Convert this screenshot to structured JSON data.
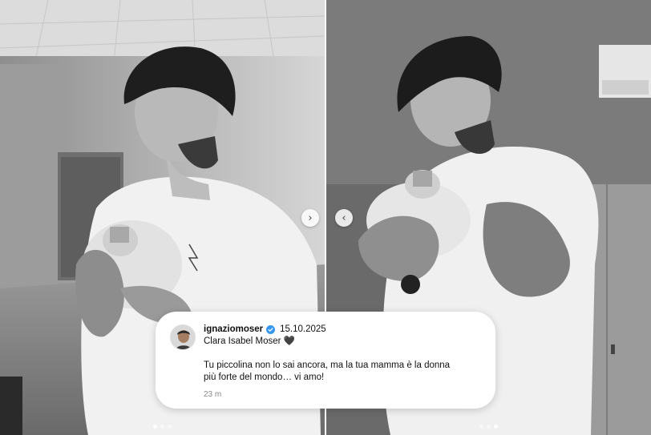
{
  "carousel_left": {
    "image_alt": "Man holding a newborn baby in a hospital room",
    "next_icon": "chevron-right-icon",
    "dots": [
      false,
      false,
      false
    ],
    "active_dot": 0
  },
  "carousel_right": {
    "image_alt": "Man smiling while cradling a newborn baby",
    "prev_icon": "chevron-left-icon",
    "active_dot": 2
  },
  "caption": {
    "username": "ignaziomoser",
    "verified": true,
    "date": "15.10.2025",
    "title_line": "Clara Isabel Moser 🖤",
    "message_line_1": "Tu piccolina non lo sai ancora, ma la tua mamma è la donna",
    "message_line_2": "più forte del mondo… vi amo!",
    "time_ago": "23 m"
  },
  "colors": {
    "verified_blue": "#3797f0",
    "card_background": "#ffffff",
    "muted_text": "#8a8a8a"
  }
}
